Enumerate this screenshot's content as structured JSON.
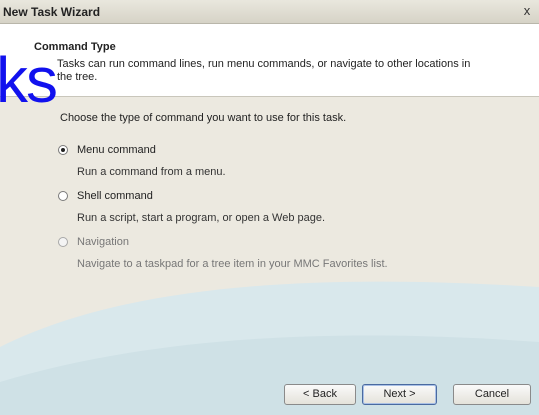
{
  "window": {
    "title": "New Task Wizard",
    "close_glyph": "x"
  },
  "header": {
    "title": "Command Type",
    "description": "Tasks can run command lines, run menu commands, or navigate to other locations in the tree."
  },
  "watermark": {
    "text": "ks",
    "color": "#1111ee"
  },
  "intro": "Choose the type of command you want to use for this task.",
  "options": [
    {
      "label": "Menu command",
      "description": "Run a command from a menu.",
      "selected": true,
      "enabled": true
    },
    {
      "label": "Shell command",
      "description": "Run a script, start a program, or open a Web page.",
      "selected": false,
      "enabled": true
    },
    {
      "label": "Navigation",
      "description": "Navigate to a taskpad for a tree item in your MMC Favorites list.",
      "selected": false,
      "enabled": false
    }
  ],
  "buttons": {
    "back": "< Back",
    "next": "Next >",
    "cancel": "Cancel"
  },
  "colors": {
    "body_bg": "#ece9e0",
    "header_bg": "#ffffff",
    "swoosh": "#d6e6ea"
  }
}
